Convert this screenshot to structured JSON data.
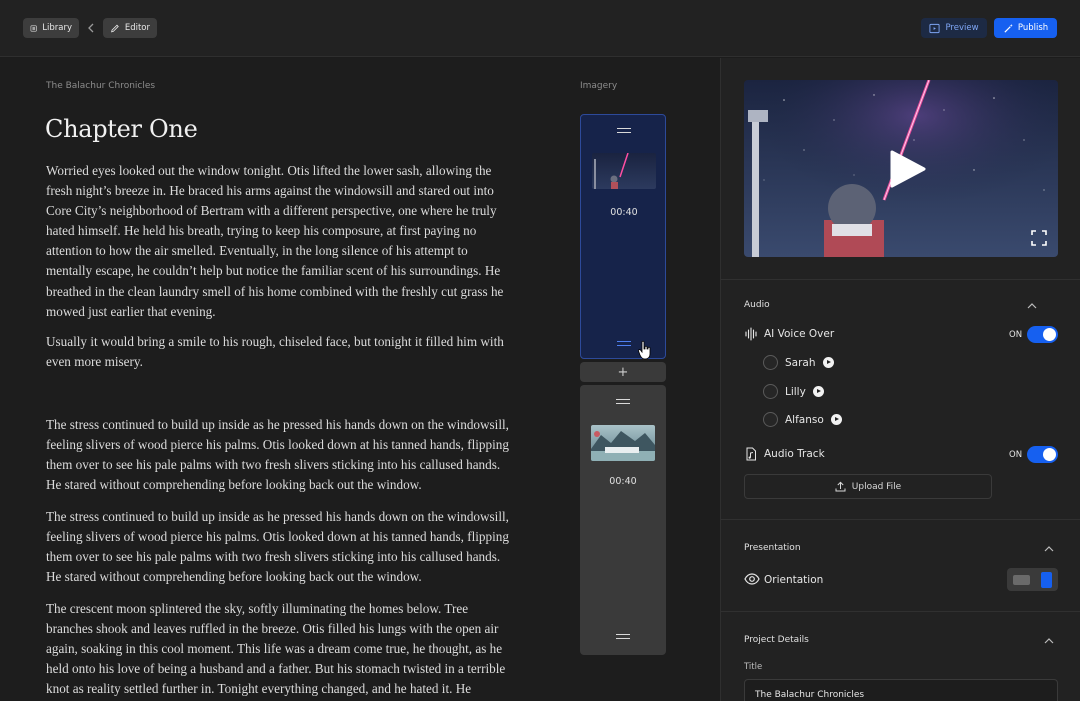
{
  "topbar": {
    "library_label": "Library",
    "editor_label": "Editor",
    "preview_label": "Preview",
    "publish_label": "Publish"
  },
  "editor": {
    "book_title": "The Balachur Chronicles",
    "chapter_title": "Chapter One",
    "paragraphs": [
      "Worried eyes looked out the window tonight. Otis lifted the lower sash, allowing the fresh night’s breeze in. He braced his arms against the windowsill and stared out into Core City’s neighborhood of Bertram with a different perspective, one where he truly hated himself. He held his breath, trying to keep his composure, at first paying no attention to how the air smelled. Eventually, in the long silence of his attempt to mentally escape, he couldn’t help but notice the familiar scent of his surroundings. He breathed in the clean laundry smell of his home combined with the freshly cut grass he mowed just earlier that evening.",
      "Usually it would bring a smile to his rough, chiseled face, but tonight it filled him with even more misery.",
      "The stress continued to build up inside as he pressed his hands down on the windowsill, feeling slivers of wood pierce his palms. Otis looked down at his tanned hands, flipping them over to see his pale palms with two fresh slivers sticking into his callused hands. He stared without comprehending before looking back out the window.",
      "The stress continued to build up inside as he pressed his hands down on the windowsill, feeling slivers of wood pierce his palms. Otis looked down at his tanned hands, flipping them over to see his pale palms with two fresh slivers sticking into his callused hands. He stared without comprehending before looking back out the window.",
      "The crescent moon splintered the sky, softly illuminating the homes below. Tree branches shook and leaves ruffled in the breeze. Otis filled his lungs with the open air again, soaking in this cool moment. This life was a dream come true, he thought, as he held onto his love of being a husband and a father. But his stomach twisted in a terrible knot as reality settled further in. Tonight everything changed, and he hated it. He"
    ]
  },
  "imagery": {
    "label": "Imagery",
    "scenes": [
      {
        "time": "00:40",
        "selected": true
      },
      {
        "time": "00:40",
        "selected": false
      }
    ],
    "add_label": "+"
  },
  "panel": {
    "audio": {
      "title": "Audio",
      "ai_voice_label": "AI Voice Over",
      "ai_voice_state": "ON",
      "voices": [
        "Sarah",
        "Lilly",
        "Alfanso"
      ],
      "audio_track_label": "Audio Track",
      "audio_track_state": "ON",
      "upload_label": "Upload File"
    },
    "presentation": {
      "title": "Presentation",
      "orientation_label": "Orientation",
      "orientation_value": "portrait"
    },
    "project": {
      "title": "Project Details",
      "title_field_label": "Title",
      "title_field_value": "The Balachur Chronicles"
    }
  },
  "colors": {
    "accent": "#1660f0",
    "background": "#1d1d1d",
    "panel": "#222222"
  }
}
